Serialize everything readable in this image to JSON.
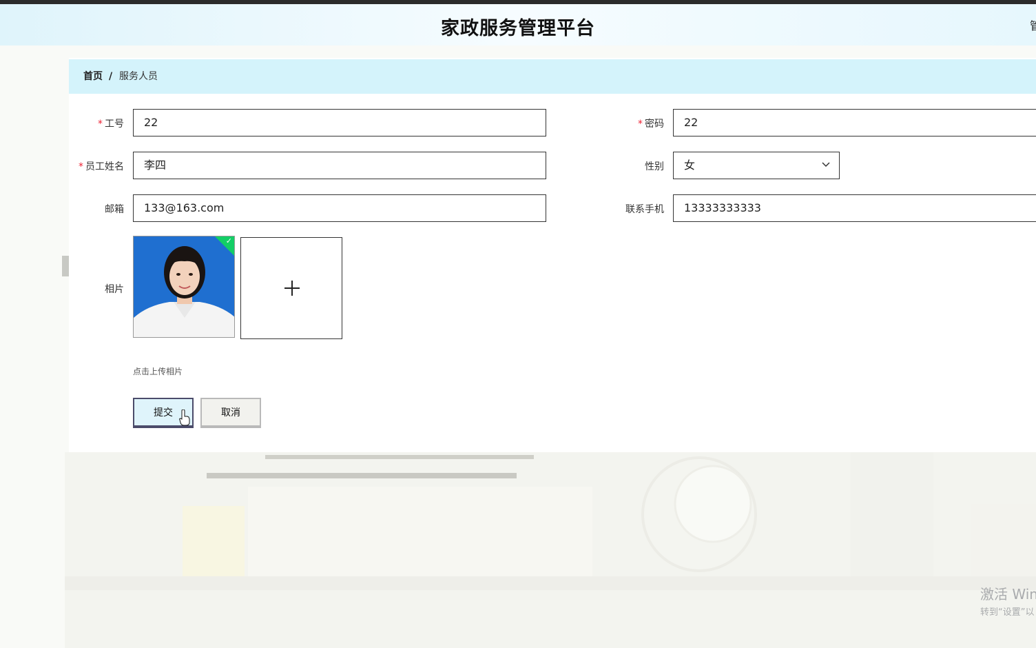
{
  "header": {
    "title": "家政服务管理平台",
    "user_chip": "管"
  },
  "breadcrumb": {
    "home": "首页",
    "separator": "/",
    "current": "服务人员"
  },
  "form": {
    "required_mark": "*",
    "job_no": {
      "label": "工号",
      "value": "22"
    },
    "password": {
      "label": "密码",
      "value": "22"
    },
    "name": {
      "label": "员工姓名",
      "value": "李四"
    },
    "gender": {
      "label": "性别",
      "value": "女"
    },
    "email": {
      "label": "邮箱",
      "value": "133@163.com"
    },
    "phone": {
      "label": "联系手机",
      "value": "13333333333"
    },
    "photo": {
      "label": "相片",
      "hint": "点击上传相片",
      "add_symbol": "+"
    }
  },
  "buttons": {
    "submit": "提交",
    "cancel": "取消"
  },
  "watermark": {
    "line1": "激活 Win",
    "line2": "转到“设置”以"
  },
  "colors": {
    "breadcrumb_bg": "#d4f3fb",
    "required": "#e23",
    "upload_success": "#13ce66"
  }
}
